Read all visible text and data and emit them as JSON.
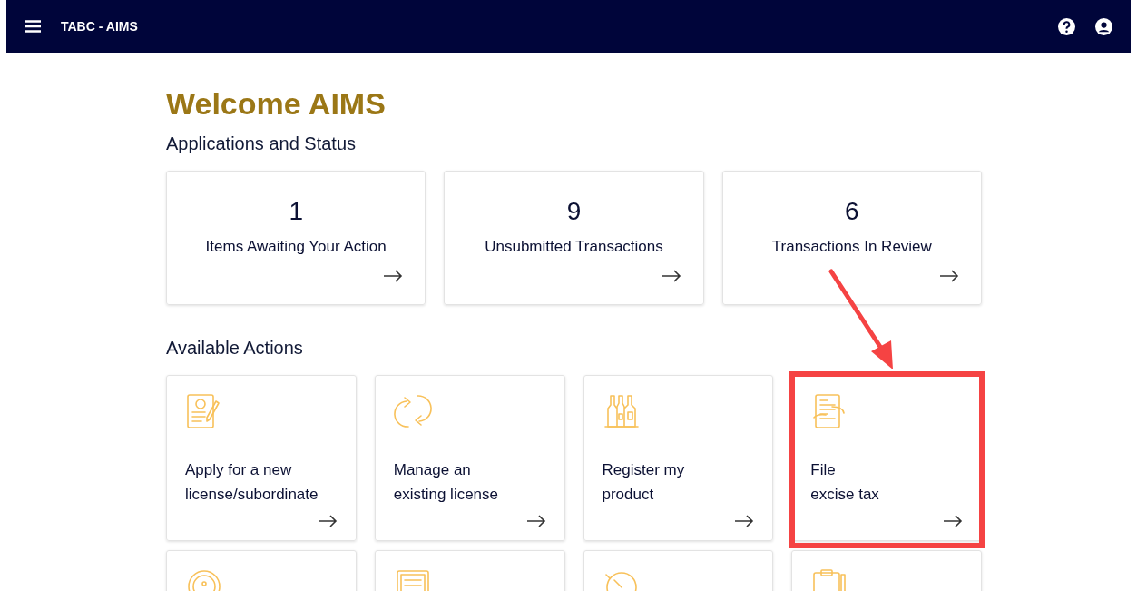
{
  "header": {
    "title": "TABC - AIMS"
  },
  "welcome": "Welcome AIMS",
  "status_section": {
    "heading": "Applications and Status",
    "cards": [
      {
        "count": "1",
        "label": "Items Awaiting Your Action"
      },
      {
        "count": "9",
        "label": "Unsubmitted Transactions"
      },
      {
        "count": "6",
        "label": "Transactions In Review"
      }
    ]
  },
  "actions_section": {
    "heading": "Available Actions",
    "cards": [
      {
        "kind": "license",
        "lines": [
          "Apply for a new",
          "license/subordinate"
        ],
        "highlighted": false
      },
      {
        "kind": "manage",
        "lines": [
          "Manage an",
          "existing license"
        ],
        "highlighted": false
      },
      {
        "kind": "product",
        "lines": [
          "Register my",
          "product"
        ],
        "highlighted": false
      },
      {
        "kind": "tax",
        "lines": [
          "File",
          "excise tax"
        ],
        "highlighted": true
      },
      {
        "kind": "seal",
        "highlighted": false
      },
      {
        "kind": "certificate",
        "highlighted": false
      },
      {
        "kind": "dial",
        "highlighted": false
      },
      {
        "kind": "clipboard",
        "highlighted": false
      }
    ]
  }
}
